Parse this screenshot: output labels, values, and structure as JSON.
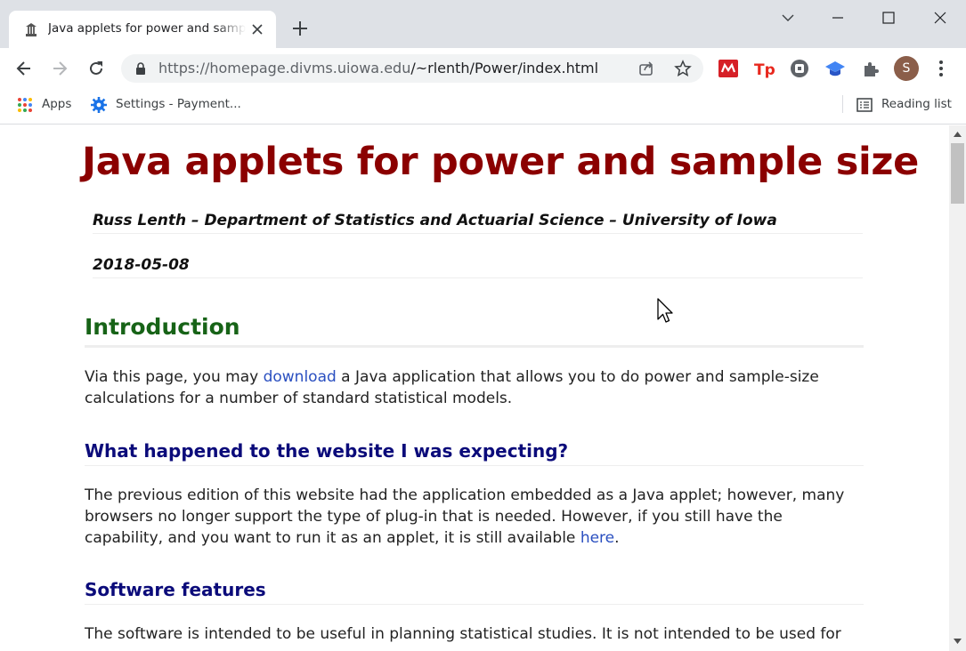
{
  "browser": {
    "tab": {
      "title": "Java applets for power and sample size"
    },
    "address_bar": {
      "url_host": "https://homepage.divms.uiowa.edu",
      "url_path": "/~rlenth/Power/index.html"
    },
    "bookmarks": [
      {
        "label": "Apps",
        "icon": "apps-grid-icon"
      },
      {
        "label": "Settings - Payment...",
        "icon": "gear-icon"
      }
    ],
    "reading_list": "Reading list",
    "profile_initial": "S",
    "accent_colors": {
      "profile": "#8b5e4a",
      "tabstrip": "#dee1e6"
    }
  },
  "page": {
    "title": "Java applets for power and sample size",
    "author_line": "Russ Lenth – Department of Statistics and Actuarial Science – University of Iowa",
    "date": "2018-05-08",
    "introduction": {
      "heading": "Introduction",
      "text_before": "Via this page, you may ",
      "link": "download",
      "text_after": " a Java application that allows you to do power and sample-size calculations for a number of standard statistical models."
    },
    "expecting": {
      "heading": "What happened to the website I was expecting?",
      "text_before": "The previous edition of this website had the application embedded as a Java applet; however, many browsers no longer support the type of plug-in that is needed. However, if you still have the capability, and you want to run it as an applet, it is still available ",
      "link": "here",
      "text_after": "."
    },
    "features": {
      "heading": "Software features",
      "text": "The software is intended to be useful in planning statistical studies. It is not intended to be used for"
    },
    "colors": {
      "title": "#8b0000",
      "h2": "#176317",
      "h3": "#0b0b7a",
      "link": "#2a4fc0"
    }
  }
}
